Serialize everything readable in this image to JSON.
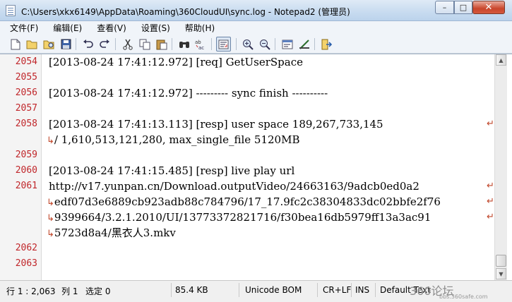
{
  "window": {
    "title": "C:\\Users\\xkx6149\\AppData\\Roaming\\360CloudUI\\sync.log - Notepad2 (管理员)",
    "minimize": "–",
    "maximize": "□",
    "close": "✕"
  },
  "menu": [
    "文件(F)",
    "编辑(E)",
    "查看(V)",
    "设置(S)",
    "帮助(H)"
  ],
  "editor": {
    "line_numbers": [
      "2054",
      "2055",
      "2056",
      "2057",
      "2058",
      "2059",
      "2060",
      "2061",
      "2062",
      "2063"
    ],
    "lines": [
      "[2013-08-24 17:41:12.972] [req] GetUserSpace",
      "",
      "[2013-08-24 17:41:12.972] --------- sync finish ----------",
      "",
      "[2013-08-24 17:41:13.113] [resp] user space 189,267,733,145",
      "/ 1,610,513,121,280, max_single_file 5120MB",
      "",
      "[2013-08-24 17:41:15.485] [resp] live play url",
      "http://v17.yunpan.cn/Download.outputVideo/24663163/9adcb0ed0a2",
      "edf07d3e6889cb923adb88c784796/17_17.9fc2c38304833dc02bbfe2f76",
      "9399664/3.2.1.2010/UI/13773372821716/f30bea16db5979ff13a3ac91",
      "5723d8a4/黑衣人3.mkv"
    ],
    "wrap_glyph_end": "↵",
    "wrap_glyph_start": "↳"
  },
  "status": {
    "position": "行 1 : 2,063",
    "column": "列 1",
    "selection": "选定 0",
    "size": "85.4 KB",
    "encoding": "Unicode BOM",
    "line_ending": "CR+LF",
    "mode": "INS",
    "scheme": "Default Text"
  },
  "watermark": {
    "logo": "360论坛",
    "url": "bbs.360safe.com"
  }
}
